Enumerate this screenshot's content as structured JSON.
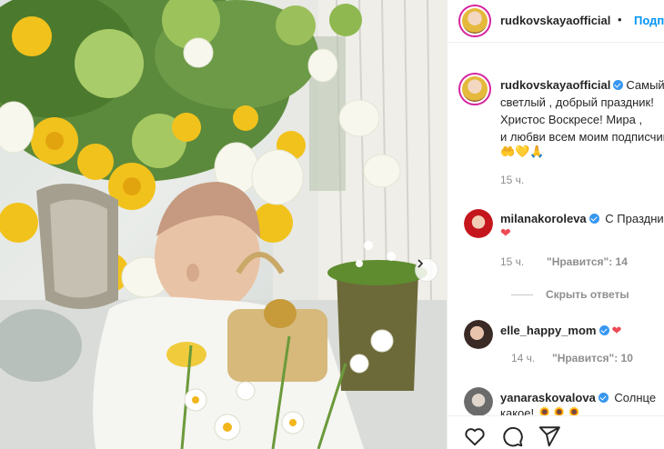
{
  "post": {
    "author": "rudkovskayaofficial",
    "follow_label": "Подписаться",
    "caption_lines": [
      "Самый",
      "светлый , добрый праздник!",
      "Христос Воскресе! Мира ,",
      "и любви всем моим подписчикам"
    ],
    "caption_emoji": "🤲💛🙏",
    "caption_time": "15 ч."
  },
  "comments": [
    {
      "user": "milanakoroleva",
      "text": "С Праздником",
      "emoji": "❤",
      "time": "15 ч.",
      "likes": "\"Нравится\": 14",
      "hide_replies": "Скрыть ответы"
    },
    {
      "user": "elle_happy_mom",
      "emoji": "❤",
      "time": "14 ч.",
      "likes": "\"Нравится\": 10"
    },
    {
      "user": "yanaraskovalova",
      "text": "Солнце",
      "line2": "какое!",
      "line2_emoji": "🌻🌻🌻"
    }
  ],
  "colors": {
    "link": "#0095f6",
    "verified": "#3897f0",
    "heart": "#ed4956",
    "story_ring": "#d6249f"
  },
  "icons": [
    "chevron-right-icon",
    "heart-icon",
    "comment-icon",
    "share-icon",
    "verified-icon"
  ]
}
